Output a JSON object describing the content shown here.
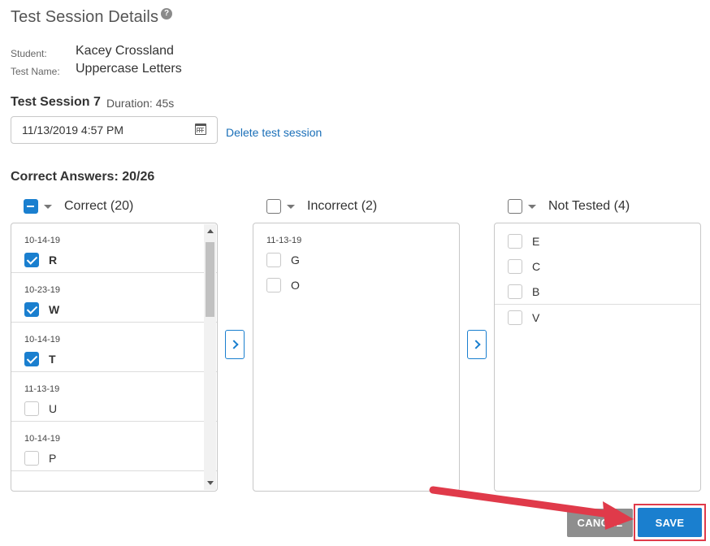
{
  "header": {
    "title": "Test Session Details",
    "help_icon": "question-circle-icon"
  },
  "meta": {
    "student_label": "Student:",
    "student_value": "Kacey Crossland",
    "test_name_label": "Test Name:",
    "test_name_value": "Uppercase Letters"
  },
  "session": {
    "title": "Test Session 7",
    "duration": "Duration: 45s",
    "date_value": "11/13/2019 4:57 PM",
    "calendar_icon": "calendar-icon",
    "delete_link": "Delete test session"
  },
  "summary": {
    "correct_answers": "Correct Answers: 20/26"
  },
  "columns": {
    "correct": {
      "label": "Correct (20)",
      "groups": [
        {
          "date": "10-14-19",
          "items": [
            {
              "letter": "R",
              "checked": true
            }
          ]
        },
        {
          "date": "10-23-19",
          "items": [
            {
              "letter": "W",
              "checked": true
            }
          ]
        },
        {
          "date": "10-14-19",
          "items": [
            {
              "letter": "T",
              "checked": true
            }
          ]
        },
        {
          "date": "11-13-19",
          "items": [
            {
              "letter": "U",
              "checked": false
            }
          ]
        },
        {
          "date": "10-14-19",
          "items": [
            {
              "letter": "P",
              "checked": false
            }
          ]
        }
      ]
    },
    "incorrect": {
      "label": "Incorrect (2)",
      "groups": [
        {
          "date": "11-13-19",
          "items": [
            {
              "letter": "G",
              "checked": false
            },
            {
              "letter": "O",
              "checked": false
            }
          ]
        }
      ]
    },
    "not_tested": {
      "label": "Not Tested (4)",
      "groups": [
        {
          "date": "",
          "items": [
            {
              "letter": "E",
              "checked": false
            },
            {
              "letter": "C",
              "checked": false
            },
            {
              "letter": "B",
              "checked": false
            }
          ]
        },
        {
          "date": "",
          "items": [
            {
              "letter": "V",
              "checked": false
            }
          ]
        }
      ]
    }
  },
  "footer": {
    "cancel_label": "CANCEL",
    "save_label": "SAVE"
  },
  "colors": {
    "accent": "#1a7fcf",
    "link": "#1a6fb8",
    "annotation": "#e03a4a"
  }
}
